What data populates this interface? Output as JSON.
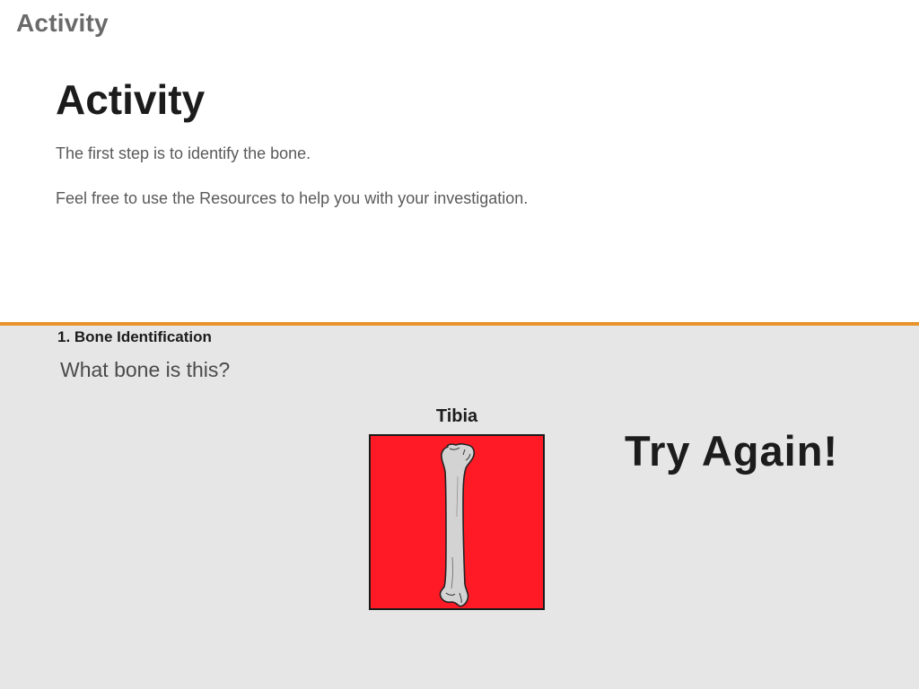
{
  "header": {
    "app_title": "Activity"
  },
  "main": {
    "title": "Activity",
    "instructions": [
      "The first step is to identify the bone.",
      "Feel free to use the Resources to help you with your investigation."
    ]
  },
  "question_panel": {
    "section_title": "1. Bone Identification",
    "question": "What bone is this?",
    "card": {
      "label": "Tibia",
      "image_icon": "bone-illustration",
      "background_color": "#ff1a25"
    },
    "feedback": "Try Again!",
    "accent_color": "#e8922c"
  }
}
